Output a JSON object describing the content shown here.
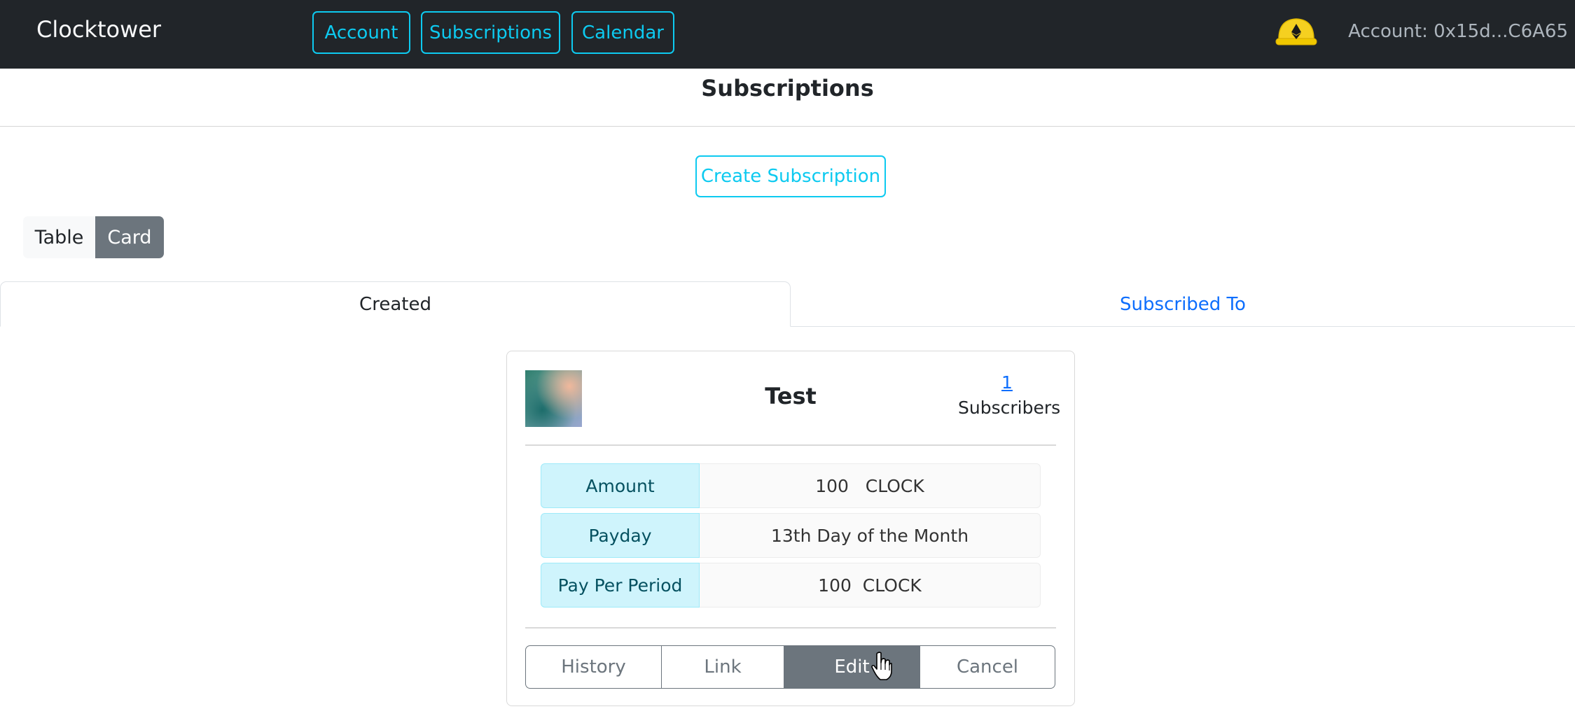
{
  "navbar": {
    "brand": "Clocktower",
    "links": [
      {
        "label": "Account"
      },
      {
        "label": "Subscriptions"
      },
      {
        "label": "Calendar"
      }
    ],
    "wallet_icon": "hardhat-eth-icon",
    "account": "Account: 0x15d...C6A65"
  },
  "page": {
    "title": "Subscriptions",
    "create_button": "Create Subscription"
  },
  "view_toggle": {
    "options": [
      "Table",
      "Card"
    ],
    "selected": "Card"
  },
  "tabs": {
    "items": [
      "Created",
      "Subscribed To"
    ],
    "active": "Created"
  },
  "card": {
    "title": "Test",
    "subscriber_count": "1",
    "subscriber_label": "Subscribers",
    "rows": [
      {
        "label": "Amount",
        "value": "100   CLOCK"
      },
      {
        "label": "Payday",
        "value": "13th Day of the Month"
      },
      {
        "label": "Pay Per Period",
        "value": "100  CLOCK"
      }
    ],
    "buttons": {
      "history": "History",
      "link": "Link",
      "edit": "Edit",
      "cancel": "Cancel"
    }
  },
  "colors": {
    "navbar_bg": "#212529",
    "accent_info": "#0dcaf0",
    "secondary": "#6c757d",
    "link_blue": "#0d6efd"
  }
}
